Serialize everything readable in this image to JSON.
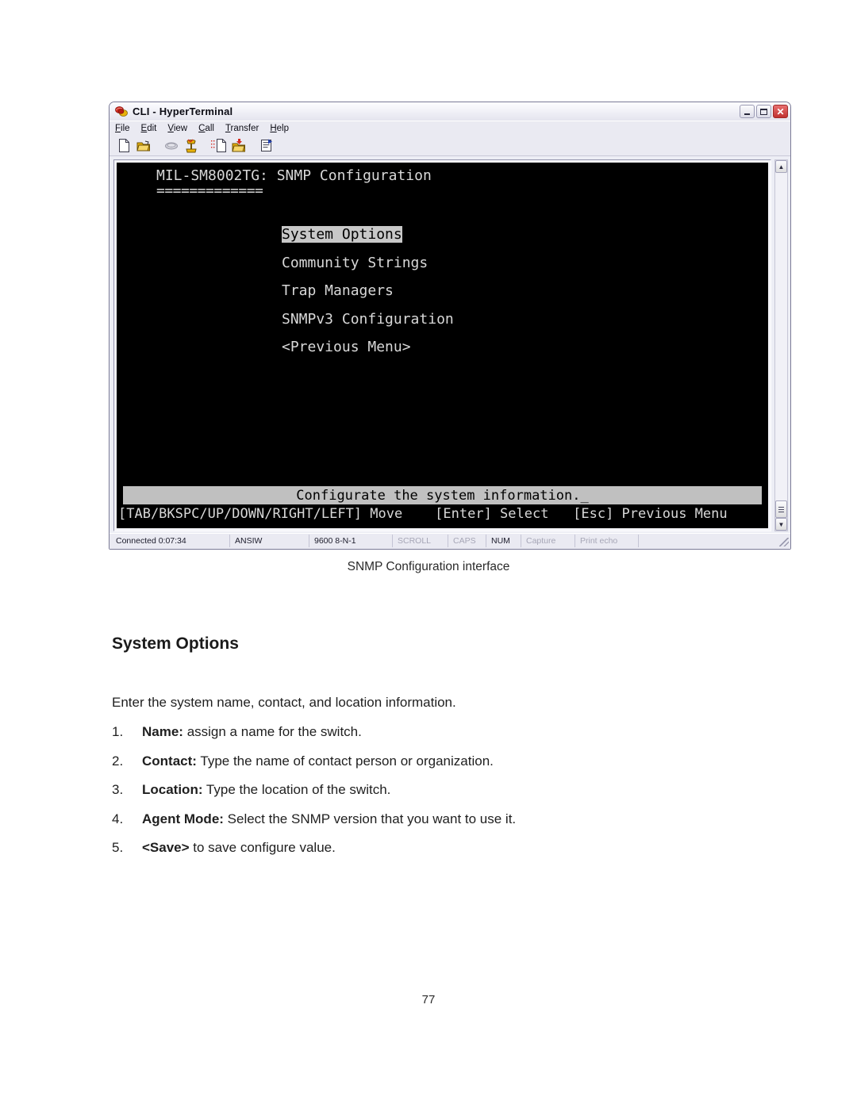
{
  "window": {
    "title": "CLI - HyperTerminal",
    "app_icon": "hyperterminal-icon",
    "caption_buttons": [
      {
        "name": "minimize",
        "label": "_"
      },
      {
        "name": "maximize",
        "label": "□"
      },
      {
        "name": "close",
        "label": "✕"
      }
    ],
    "menubar": [
      {
        "label": "File",
        "accel": "F"
      },
      {
        "label": "Edit",
        "accel": "E"
      },
      {
        "label": "View",
        "accel": "V"
      },
      {
        "label": "Call",
        "accel": "C"
      },
      {
        "label": "Transfer",
        "accel": "T"
      },
      {
        "label": "Help",
        "accel": "H"
      }
    ],
    "toolbar": [
      {
        "name": "new-connection-icon",
        "glyph": "page"
      },
      {
        "name": "open-icon",
        "glyph": "folder"
      },
      {
        "name": "call-icon",
        "glyph": "phone-disabled"
      },
      {
        "name": "disconnect-icon",
        "glyph": "phone-hangup"
      },
      {
        "name": "send-file-icon",
        "glyph": "send"
      },
      {
        "name": "receive-file-icon",
        "glyph": "receive"
      },
      {
        "name": "properties-icon",
        "glyph": "properties"
      }
    ],
    "scrollbar": {
      "up_arrow": "▲",
      "down_arrow": "▼"
    },
    "statusbar": [
      {
        "name": "connection-time",
        "text": "Connected 0:07:34",
        "dim": false
      },
      {
        "name": "emulation",
        "text": "ANSIW",
        "dim": false
      },
      {
        "name": "line-settings",
        "text": "9600 8-N-1",
        "dim": false
      },
      {
        "name": "scroll-indicator",
        "text": "SCROLL",
        "dim": true
      },
      {
        "name": "caps-indicator",
        "text": "CAPS",
        "dim": true
      },
      {
        "name": "num-indicator",
        "text": "NUM",
        "dim": false
      },
      {
        "name": "capture-indicator",
        "text": "Capture",
        "dim": true
      },
      {
        "name": "print-echo-indicator",
        "text": "Print echo",
        "dim": true
      }
    ]
  },
  "terminal": {
    "title": "MIL-SM8002TG: SNMP Configuration",
    "underline": "=============",
    "menu_items": [
      {
        "label": "System Options",
        "selected": true
      },
      {
        "label": "Community Strings",
        "selected": false
      },
      {
        "label": "Trap Managers",
        "selected": false
      },
      {
        "label": "SNMPv3 Configuration",
        "selected": false
      },
      {
        "label": "<Previous Menu>",
        "selected": false
      }
    ],
    "status_message": "Configurate the system information._",
    "key_help": "[TAB/BKSPC/UP/DOWN/RIGHT/LEFT] Move    [Enter] Select   [Esc] Previous Menu"
  },
  "document": {
    "figure_caption": "SNMP Configuration interface",
    "heading": "System Options",
    "intro": "Enter the system name, contact, and location information.",
    "items": [
      {
        "num": "1.",
        "bold": "Name:",
        "rest": " assign a name for the switch."
      },
      {
        "num": "2.",
        "bold": "Contact:",
        "rest": " Type the name of contact person or organization."
      },
      {
        "num": "3.",
        "bold": "Location:",
        "rest": " Type the location of the switch."
      },
      {
        "num": "4.",
        "bold": "Agent Mode:",
        "rest": " Select the SNMP version that you want to use it."
      },
      {
        "num": "5.",
        "bold": "<Save>",
        "rest": " to save configure value."
      }
    ],
    "page_number": "77"
  },
  "colors": {
    "terminal_bg": "#000000",
    "terminal_fg": "#d8d8d8",
    "terminal_highlight_bg": "#c0c0c0",
    "window_chrome": "#eaeaf2",
    "close_button": "#c03030"
  }
}
